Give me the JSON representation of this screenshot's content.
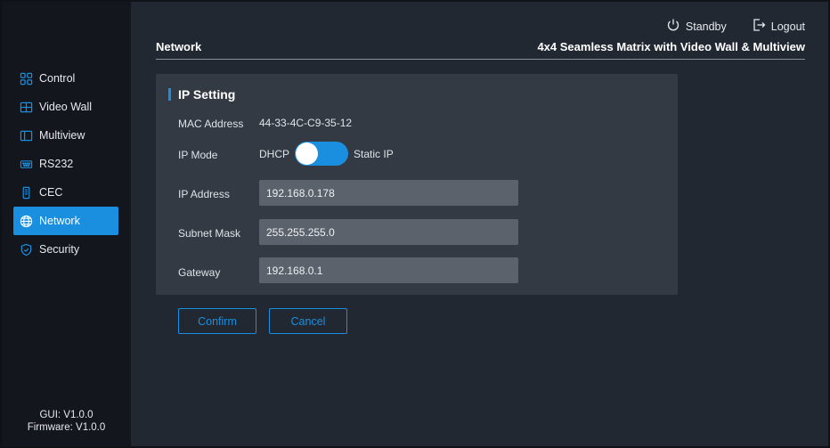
{
  "sidebar": {
    "items": [
      {
        "label": "Control",
        "icon": "grid-icon"
      },
      {
        "label": "Video Wall",
        "icon": "video-wall-icon"
      },
      {
        "label": "Multiview",
        "icon": "multiview-icon"
      },
      {
        "label": "RS232",
        "icon": "rs232-icon"
      },
      {
        "label": "CEC",
        "icon": "remote-icon"
      },
      {
        "label": "Network",
        "icon": "globe-icon",
        "active": true
      },
      {
        "label": "Security",
        "icon": "shield-icon"
      }
    ],
    "gui_version": "GUI: V1.0.0",
    "firmware_version": "Firmware: V1.0.0"
  },
  "topbar": {
    "standby_label": "Standby",
    "logout_label": "Logout"
  },
  "header": {
    "page_title": "Network",
    "device_title": "4x4 Seamless Matrix with Video Wall & Multiview"
  },
  "ip_setting": {
    "title": "IP Setting",
    "mac_label": "MAC Address",
    "mac_value": "44-33-4C-C9-35-12",
    "mode_label": "IP Mode",
    "mode_dhcp": "DHCP",
    "mode_static": "Static IP",
    "ip_label": "IP Address",
    "ip_value": "192.168.0.178",
    "subnet_label": "Subnet Mask",
    "subnet_value": "255.255.255.0",
    "gateway_label": "Gateway",
    "gateway_value": "192.168.0.1"
  },
  "actions": {
    "confirm_label": "Confirm",
    "cancel_label": "Cancel"
  },
  "colors": {
    "accent": "#1a8fe0",
    "sidebar_bg": "#13161c",
    "main_bg": "#222831",
    "card_bg": "#333a44",
    "field_bg": "#5c626b"
  }
}
